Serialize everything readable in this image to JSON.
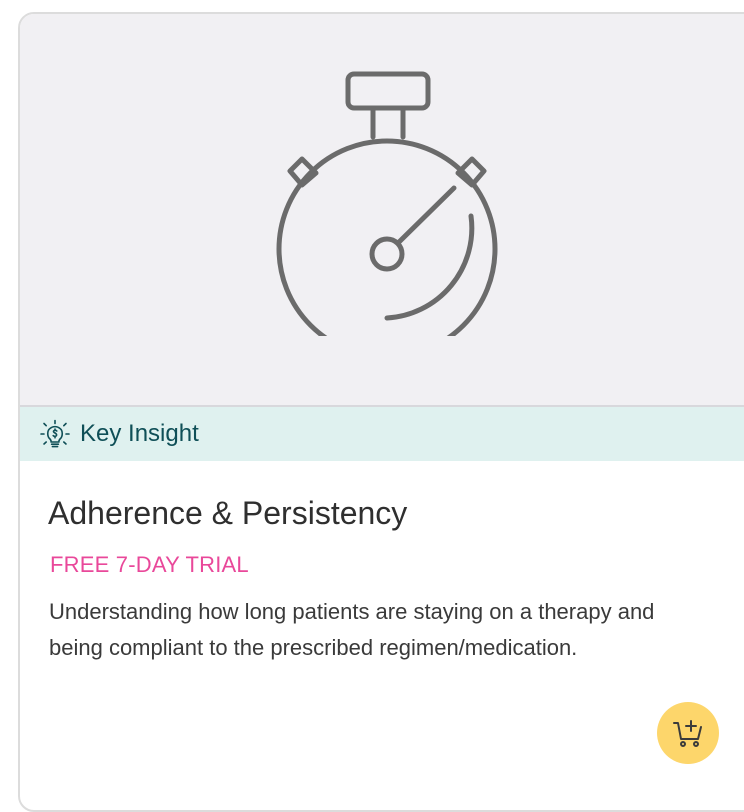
{
  "hero": {
    "icon": "stopwatch-icon",
    "background_color": "#f1f0f3"
  },
  "insight": {
    "icon": "lightbulb-icon",
    "label": "Key Insight",
    "background_color": "#dff1ef",
    "text_color": "#0f4f57"
  },
  "product": {
    "title": "Adherence & Persistency",
    "trial_label": "FREE 7-DAY TRIAL",
    "trial_color": "#e9489a",
    "description": "Understanding how long patients are staying on a therapy and being compliant to the prescribed regimen/medication."
  },
  "cart": {
    "icon": "add-to-cart-icon",
    "button_color": "#fdd66b"
  }
}
